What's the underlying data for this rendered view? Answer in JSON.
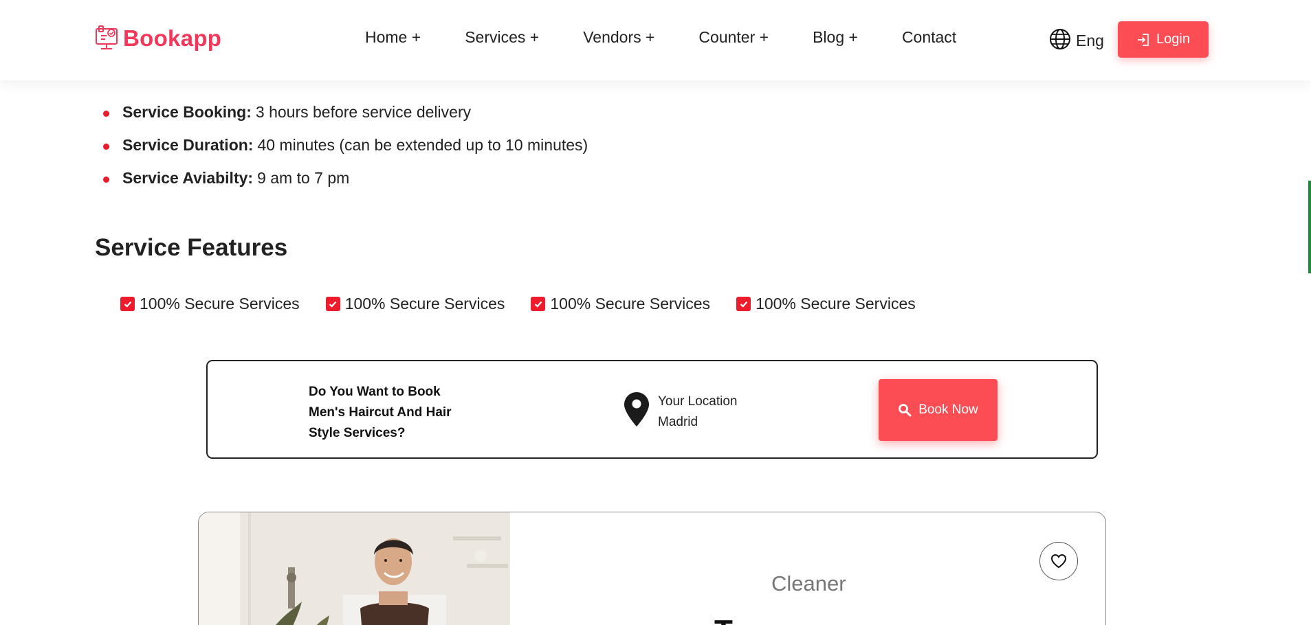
{
  "header": {
    "brand": "Bookapp",
    "nav": [
      "Home +",
      "Services +",
      "Vendors +",
      "Counter +",
      "Blog +",
      "Contact"
    ],
    "language": "Eng",
    "login_label": "Login"
  },
  "service_info": [
    {
      "label": "Service Booking:",
      "value": "3 hours before service delivery"
    },
    {
      "label": "Service Duration:",
      "value": "40 minutes (can be extended up to 10 minutes)"
    },
    {
      "label": "Service Aviabilty:",
      "value": "9 am to 7 pm"
    }
  ],
  "features": {
    "title": "Service Features",
    "items": [
      "100% Secure Services",
      "100% Secure Services",
      "100% Secure Services",
      "100% Secure Services"
    ]
  },
  "booking": {
    "question": "Do You Want to Book Men's Haircut And Hair Style Services?",
    "location_label": "Your Location",
    "location_value": "Madrid",
    "button_label": "Book Now"
  },
  "vendor": {
    "category": "Cleaner",
    "title": "T"
  },
  "colors": {
    "brand": "#f2385a",
    "accent": "#fc4c54",
    "bullet": "#ee1b2d",
    "scroll_accent": "#1e8a3a"
  },
  "icons": [
    "logo-icon",
    "globe-icon",
    "login-icon",
    "check-icon",
    "location-pin-icon",
    "search-icon",
    "heart-icon"
  ]
}
